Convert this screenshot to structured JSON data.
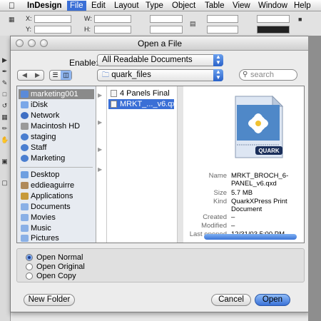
{
  "menubar": {
    "app_name": "InDesign",
    "items": [
      "File",
      "Edit",
      "Layout",
      "Type",
      "Object",
      "Table",
      "View",
      "Window",
      "Help"
    ],
    "active": "File"
  },
  "controlbar": {
    "x_label": "X:",
    "y_label": "Y:",
    "w_label": "W:",
    "h_label": "H:"
  },
  "dialog": {
    "title": "Open a File",
    "enable_label": "Enable:",
    "enable_value": "All Readable Documents",
    "location": "quark_files",
    "search_placeholder": "search",
    "sidebar": {
      "devices": [
        "marketing001",
        "iDisk",
        "Network",
        "Macintosh HD",
        "staging",
        "Staff",
        "Marketing"
      ],
      "places": [
        "Desktop",
        "eddieaguirre",
        "Applications",
        "Documents",
        "Movies",
        "Music",
        "Pictures"
      ],
      "selected": "marketing001"
    },
    "files": [
      "4 Panels Final",
      "MRKT_..._v6.qxd"
    ],
    "selected_file": "MRKT_..._v6.qxd",
    "preview": {
      "logo_text": "QUARK",
      "name_label": "Name",
      "name_value": "MRKT_BROCH_6-PANEL_v6.qxd",
      "size_label": "Size",
      "size_value": "5.7 MB",
      "kind_label": "Kind",
      "kind_value": "QuarkXPress Print Document",
      "created_label": "Created",
      "created_value": "–",
      "modified_label": "Modified",
      "modified_value": "–",
      "opened_label": "Last opened",
      "opened_value": "12/31/03 5:00 PM"
    },
    "open_options": [
      "Open Normal",
      "Open Original",
      "Open Copy"
    ],
    "selected_option": "Open Normal",
    "new_folder_label": "New Folder",
    "cancel_label": "Cancel",
    "open_label": "Open"
  },
  "colors": {
    "accent": "#3a6fd6",
    "selection_gray": "#8a8a8a"
  }
}
